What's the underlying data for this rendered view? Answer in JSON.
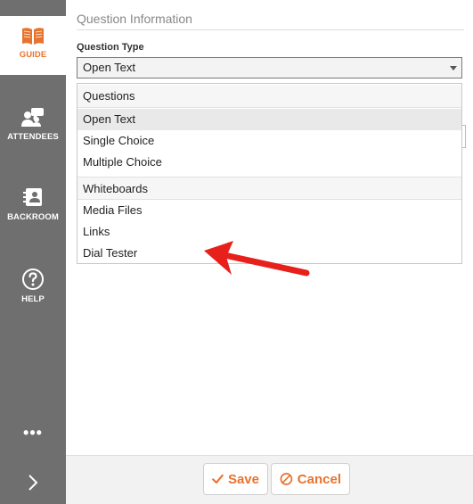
{
  "sidebar": {
    "items": [
      {
        "label": "GUIDE",
        "icon": "book-open-icon",
        "active": true
      },
      {
        "label": "ATTENDEES",
        "icon": "people-chat-icon"
      },
      {
        "label": "BACKROOM",
        "icon": "contact-card-icon"
      },
      {
        "label": "HELP",
        "icon": "help-circle-icon"
      }
    ],
    "more_label": "•••",
    "expand_icon": "chevron-right-icon"
  },
  "form": {
    "section_title": "Question Information",
    "field_label": "Question Type",
    "selected_value": "Open Text",
    "dropdown": {
      "groups": [
        {
          "label": "Questions",
          "options": [
            "Open Text",
            "Single Choice",
            "Multiple Choice"
          ]
        },
        {
          "label": "Whiteboards",
          "options": [
            "Media Files",
            "Links",
            "Dial Tester"
          ]
        }
      ]
    }
  },
  "annotation": {
    "color": "#e8201c",
    "points_to": "Dial Tester"
  },
  "footer": {
    "save_label": "Save",
    "cancel_label": "Cancel"
  },
  "colors": {
    "accent": "#e8732c",
    "sidebar_bg": "#6f6f6f",
    "footer_bg": "#f2f2f2"
  }
}
